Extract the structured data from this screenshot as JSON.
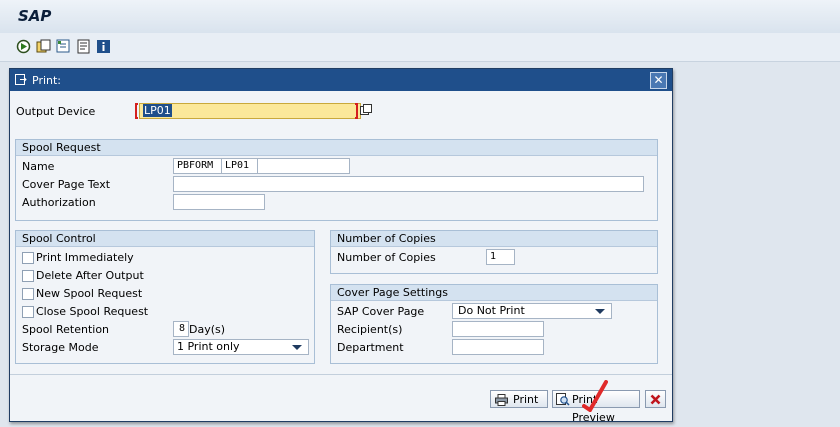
{
  "app": {
    "title": "SAP"
  },
  "toolbar": {
    "icons": [
      "execute-icon",
      "copy-icon",
      "find-icon",
      "print-list-icon",
      "info-icon"
    ]
  },
  "dialog": {
    "title": "Print:",
    "output_device": {
      "label": "Output Device",
      "value": "LP01"
    },
    "spool_request": {
      "title": "Spool Request",
      "name_label": "Name",
      "name_parts": [
        "PBFORM",
        "LP01",
        ""
      ],
      "cover_page_text_label": "Cover Page Text",
      "cover_page_text_value": "",
      "authorization_label": "Authorization",
      "authorization_value": ""
    },
    "spool_control": {
      "title": "Spool Control",
      "checkboxes": [
        {
          "label": "Print Immediately",
          "checked": false
        },
        {
          "label": "Delete After Output",
          "checked": false
        },
        {
          "label": "New Spool Request",
          "checked": false
        },
        {
          "label": "Close Spool Request",
          "checked": false
        }
      ],
      "retention_label": "Spool Retention",
      "retention_value": "8",
      "retention_unit": "Day(s)",
      "storage_label": "Storage Mode",
      "storage_value": "1 Print only"
    },
    "number_of_copies": {
      "title": "Number of Copies",
      "label": "Number of Copies",
      "value": "1"
    },
    "cover_page_settings": {
      "title": "Cover Page Settings",
      "sap_cover_label": "SAP Cover Page",
      "sap_cover_value": "Do Not Print",
      "recipient_label": "Recipient(s)",
      "recipient_value": "",
      "department_label": "Department",
      "department_value": ""
    },
    "buttons": {
      "print": "Print",
      "print_preview": "Print Preview"
    }
  },
  "colors": {
    "header_blue": "#1f4f8b",
    "field_highlight": "#fbe89a",
    "required_marker": "#d41f1f"
  }
}
